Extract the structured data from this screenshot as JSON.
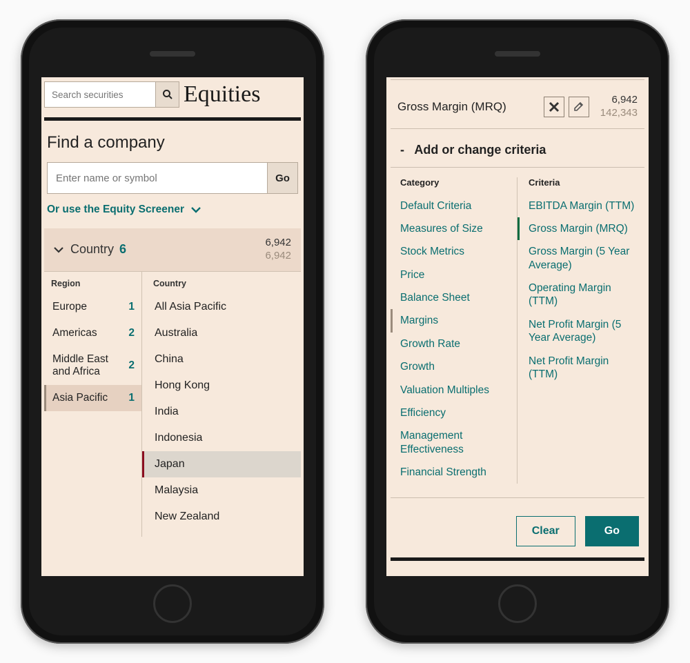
{
  "left": {
    "search": {
      "placeholder": "Search securities"
    },
    "title": "Equities",
    "find_title": "Find a company",
    "name_input": {
      "placeholder": "Enter name or symbol"
    },
    "go_small": "Go",
    "screener_link": "Or use the Equity Screener",
    "country_section": {
      "label": "Country",
      "badge": "6",
      "count1": "6,942",
      "count2": "6,942",
      "region_header": "Region",
      "country_header": "Country"
    },
    "regions": [
      {
        "label": "Europe",
        "count": "1"
      },
      {
        "label": "Americas",
        "count": "2"
      },
      {
        "label": "Middle East and Africa",
        "count": "2"
      },
      {
        "label": "Asia Pacific",
        "count": "1"
      }
    ],
    "region_selected_index": 3,
    "countries": [
      "All Asia Pacific",
      "Australia",
      "China",
      "Hong Kong",
      "India",
      "Indonesia",
      "Japan",
      "Malaysia",
      "New Zealand"
    ],
    "country_selected_index": 6
  },
  "right": {
    "criterion": {
      "name": "Gross Margin (MRQ)",
      "count1": "6,942",
      "count2": "142,343"
    },
    "add_change_label": "Add or change criteria",
    "category_header": "Category",
    "criteria_header": "Criteria",
    "categories": [
      "Default Criteria",
      "Measures of Size",
      "Stock Metrics",
      "Price",
      "Balance Sheet",
      "Margins",
      "Growth Rate",
      "Growth",
      "Valuation Multiples",
      "Efficiency",
      "Management Effectiveness",
      "Financial Strength"
    ],
    "category_selected_index": 5,
    "criteria": [
      "EBITDA Margin (TTM)",
      "Gross Margin (MRQ)",
      "Gross Margin (5 Year Average)",
      "Operating Margin (TTM)",
      "Net Profit Margin (5 Year Average)",
      "Net Profit Margin (TTM)"
    ],
    "criteria_selected_index": 1,
    "buttons": {
      "clear": "Clear",
      "go": "Go"
    }
  }
}
